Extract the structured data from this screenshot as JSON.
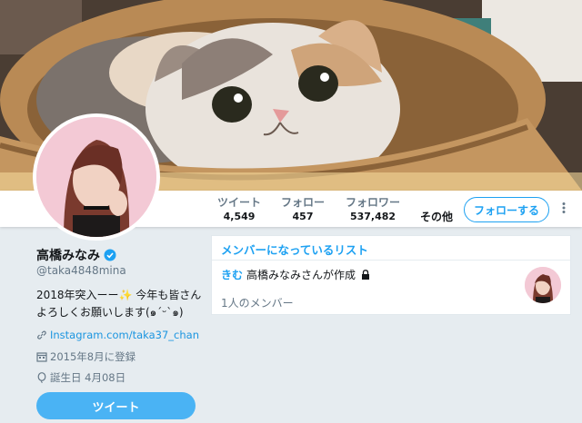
{
  "profile": {
    "name": "高橋みなみ",
    "handle": "@taka4848mina",
    "bio": "2018年突入ーー✨ 今年も皆さんよろしくお願いします(๑ˊᵕˋ๑)",
    "website": "Instagram.com/taka37_chan",
    "joined": "2015年8月に登録",
    "birthday": "誕生日 4月08日",
    "tweet_button": "ツイート"
  },
  "nav": {
    "stats": [
      {
        "label": "ツイート",
        "value": "4,549"
      },
      {
        "label": "フォロー",
        "value": "457"
      },
      {
        "label": "フォロワー",
        "value": "537,482"
      }
    ],
    "more": "その他",
    "follow_button": "フォローする"
  },
  "lists": {
    "title": "メンバーになっているリスト",
    "item": {
      "name": "きむ",
      "by": "高橋みなみさんが作成",
      "members": "1人のメンバー"
    }
  },
  "colors": {
    "accent": "#1da1f2",
    "tweet_button": "#4ab3f4",
    "background": "#e6ecf0"
  },
  "icons": [
    "verified-badge-icon",
    "link-icon",
    "calendar-icon",
    "balloon-icon",
    "lock-icon",
    "more-dots-icon"
  ]
}
